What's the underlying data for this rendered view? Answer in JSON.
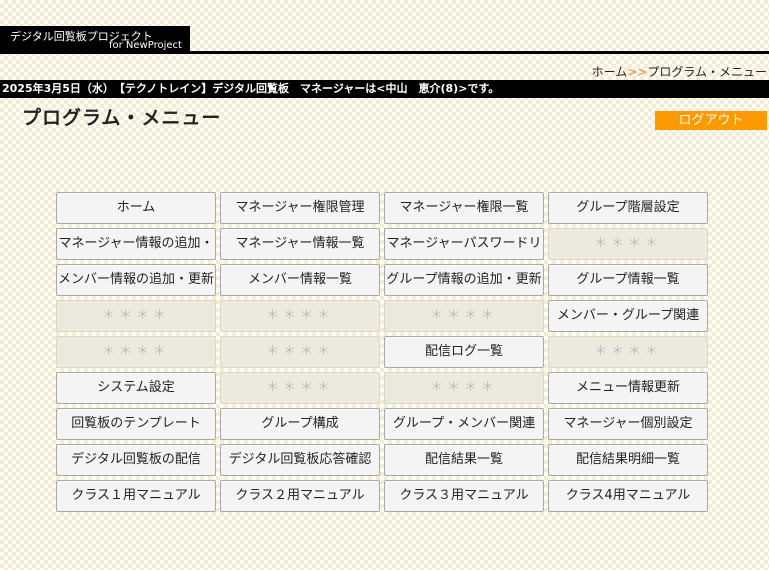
{
  "header": {
    "logo_line1": "デジタル回覧板プロジェクト",
    "logo_line2": "for NewProject"
  },
  "breadcrumb": {
    "home": "ホーム",
    "separator": ">>",
    "current": "プログラム・メニュー"
  },
  "info_bar": {
    "text": "2025年3月5日（水）　【テクノトレイン】デジタル回覧板　マネージャーは<中山　恵介(8)>です。"
  },
  "page": {
    "title": "プログラム・メニュー",
    "logout_label": "ログアウト"
  },
  "menu": [
    {
      "label": "ホーム",
      "enabled": true
    },
    {
      "label": "マネージャー権限管理",
      "enabled": true
    },
    {
      "label": "マネージャー権限一覧",
      "enabled": true
    },
    {
      "label": "グループ階層設定",
      "enabled": true
    },
    {
      "label": "マネージャー情報の追加・",
      "enabled": true
    },
    {
      "label": "マネージャー情報一覧",
      "enabled": true
    },
    {
      "label": "マネージャーパスワードリ",
      "enabled": true
    },
    {
      "label": "＊＊＊＊",
      "enabled": false
    },
    {
      "label": "メンバー情報の追加・更新",
      "enabled": true
    },
    {
      "label": "メンバー情報一覧",
      "enabled": true
    },
    {
      "label": "グループ情報の追加・更新",
      "enabled": true
    },
    {
      "label": "グループ情報一覧",
      "enabled": true
    },
    {
      "label": "＊＊＊＊",
      "enabled": false
    },
    {
      "label": "＊＊＊＊",
      "enabled": false
    },
    {
      "label": "＊＊＊＊",
      "enabled": false
    },
    {
      "label": "メンバー・グループ関連",
      "enabled": true
    },
    {
      "label": "＊＊＊＊",
      "enabled": false
    },
    {
      "label": "＊＊＊＊",
      "enabled": false
    },
    {
      "label": "配信ログ一覧",
      "enabled": true
    },
    {
      "label": "＊＊＊＊",
      "enabled": false
    },
    {
      "label": "システム設定",
      "enabled": true
    },
    {
      "label": "＊＊＊＊",
      "enabled": false
    },
    {
      "label": "＊＊＊＊",
      "enabled": false
    },
    {
      "label": "メニュー情報更新",
      "enabled": true
    },
    {
      "label": "回覧板のテンプレート",
      "enabled": true
    },
    {
      "label": "グループ構成",
      "enabled": true
    },
    {
      "label": "グループ・メンバー関連",
      "enabled": true
    },
    {
      "label": "マネージャー個別設定",
      "enabled": true
    },
    {
      "label": "デジタル回覧板の配信",
      "enabled": true
    },
    {
      "label": "デジタル回覧板応答確認",
      "enabled": true
    },
    {
      "label": "配信結果一覧",
      "enabled": true
    },
    {
      "label": "配信結果明細一覧",
      "enabled": true
    },
    {
      "label": "クラス１用マニュアル",
      "enabled": true
    },
    {
      "label": "クラス２用マニュアル",
      "enabled": true
    },
    {
      "label": "クラス３用マニュアル",
      "enabled": true
    },
    {
      "label": "クラス4用マニュアル",
      "enabled": true
    }
  ]
}
